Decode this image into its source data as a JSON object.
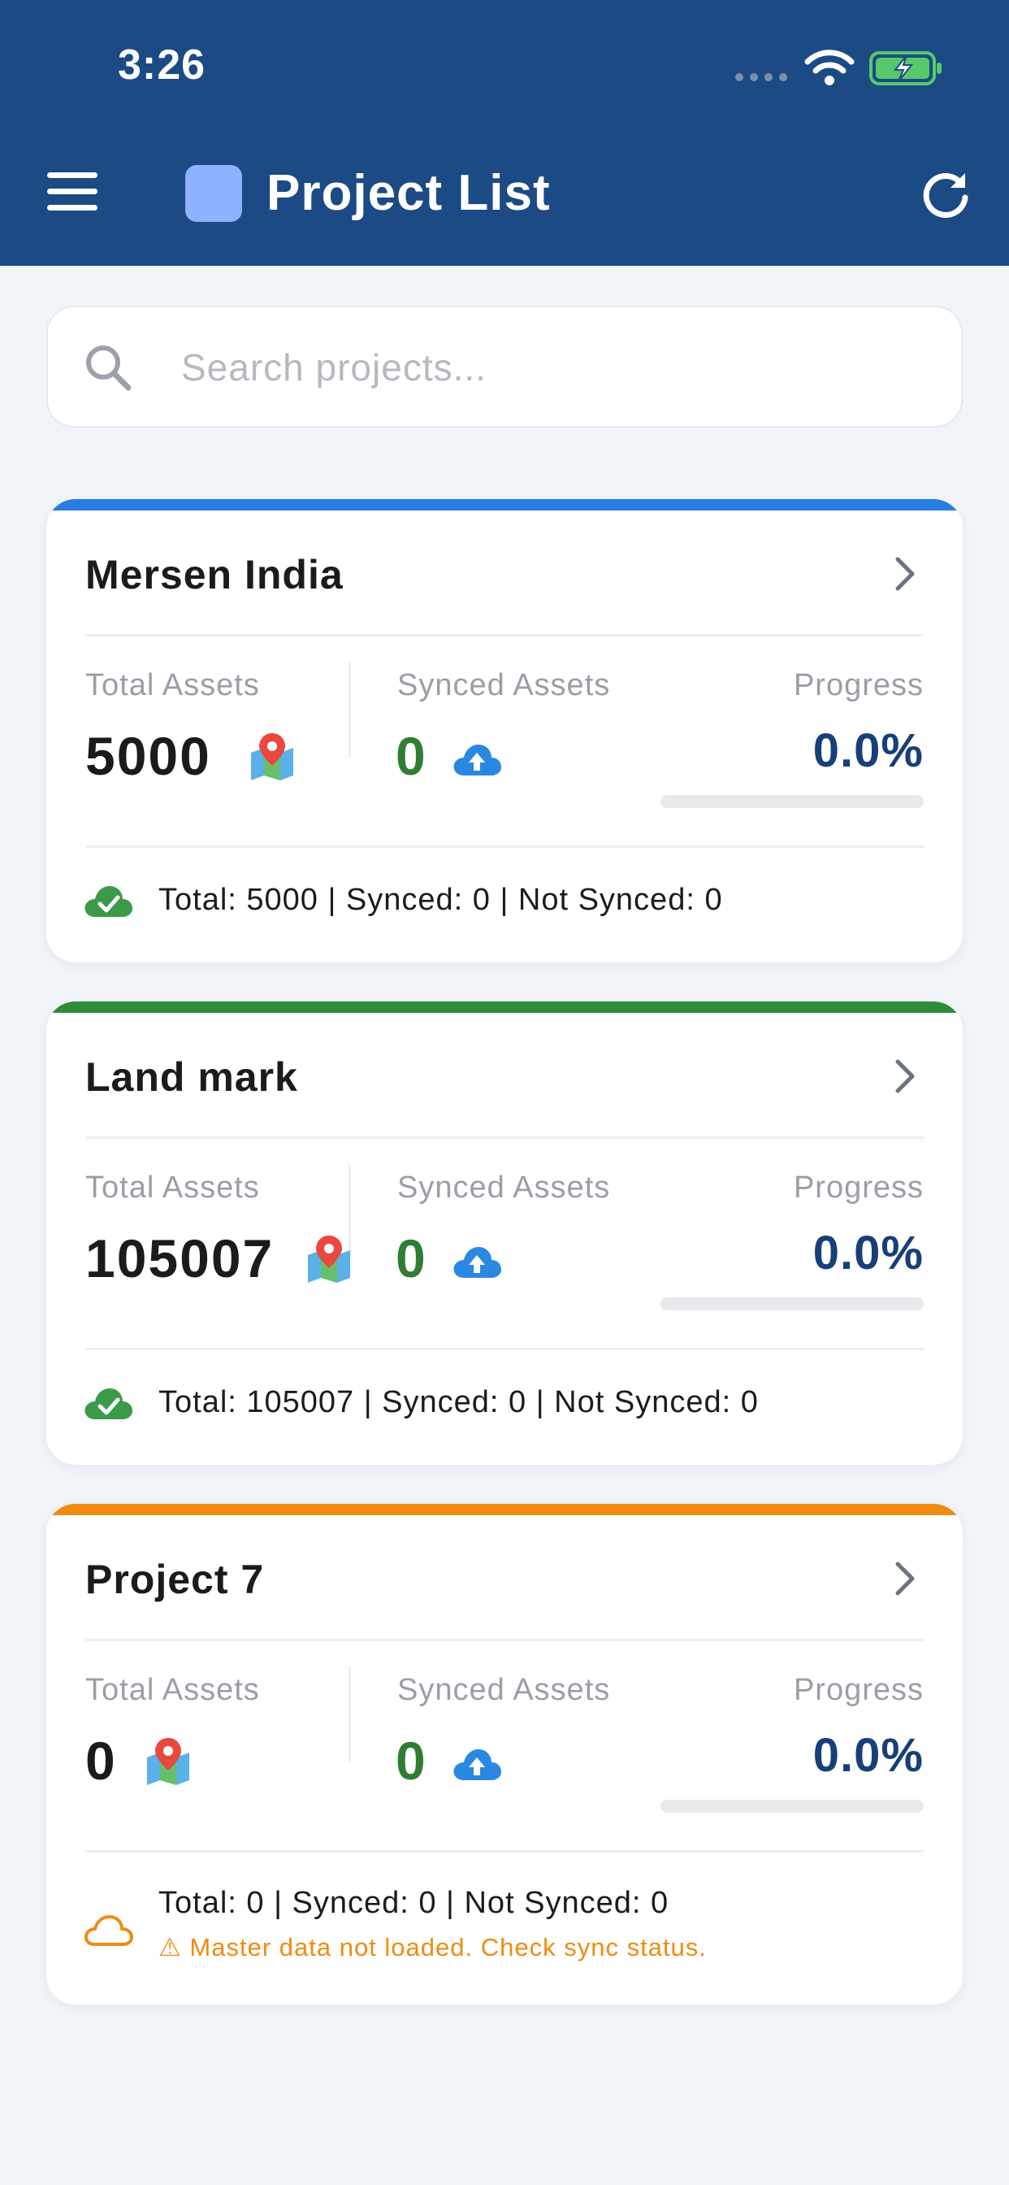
{
  "status_bar": {
    "time": "3:26"
  },
  "header": {
    "title": "Project List"
  },
  "search": {
    "placeholder": "Search projects...",
    "value": ""
  },
  "labels": {
    "total_assets": "Total Assets",
    "synced_assets": "Synced Assets",
    "progress": "Progress"
  },
  "colors": {
    "header_bg": "#1c4a85",
    "accent_blue": "#2a7de1",
    "accent_green": "#2e7d32",
    "accent_orange": "#f08a12"
  },
  "projects": [
    {
      "name": "Mersen India",
      "accent": "#2a7de1",
      "total_assets": "5000",
      "synced_assets": "0",
      "progress_text": "0.0%",
      "progress_fraction": 0.0,
      "summary": "Total: 5000 | Synced: 0 | Not Synced: 0",
      "status_icon": "cloud-check-icon",
      "warning": ""
    },
    {
      "name": "Land mark",
      "accent": "#2e8b3a",
      "total_assets": "105007",
      "synced_assets": "0",
      "progress_text": "0.0%",
      "progress_fraction": 0.0,
      "summary": "Total: 105007 | Synced: 0 | Not Synced: 0",
      "status_icon": "cloud-check-icon",
      "warning": ""
    },
    {
      "name": "Project 7",
      "accent": "#f08a12",
      "total_assets": "0",
      "synced_assets": "0",
      "progress_text": "0.0%",
      "progress_fraction": 0.0,
      "summary": "Total: 0 | Synced: 0 | Not Synced: 0",
      "status_icon": "cloud-outline-icon",
      "warning": "⚠ Master data not loaded. Check sync status."
    }
  ]
}
